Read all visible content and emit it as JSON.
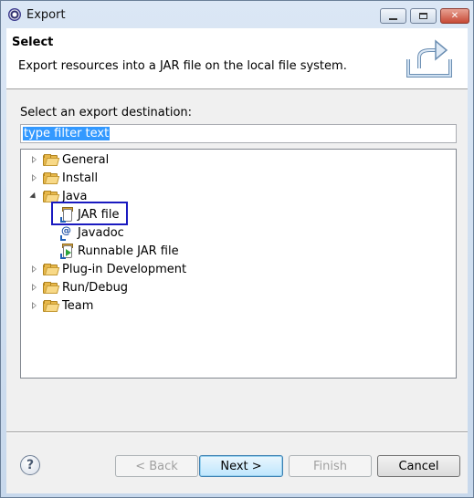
{
  "window": {
    "title": "Export"
  },
  "banner": {
    "title": "Select",
    "description": "Export resources into a JAR file on the local file system.",
    "icon": "export-icon"
  },
  "destination_label": "Select an export destination:",
  "filter": {
    "value": "type filter text"
  },
  "tree": {
    "items": [
      {
        "label": "General",
        "kind": "folder",
        "expanded": false
      },
      {
        "label": "Install",
        "kind": "folder",
        "expanded": false
      },
      {
        "label": "Java",
        "kind": "folder",
        "expanded": true
      },
      {
        "label": "JAR file",
        "kind": "jar",
        "selected": true
      },
      {
        "label": "Javadoc",
        "kind": "javadoc"
      },
      {
        "label": "Runnable JAR file",
        "kind": "runnable-jar"
      },
      {
        "label": "Plug-in Development",
        "kind": "folder",
        "expanded": false
      },
      {
        "label": "Run/Debug",
        "kind": "folder",
        "expanded": false
      },
      {
        "label": "Team",
        "kind": "folder",
        "expanded": false
      }
    ]
  },
  "buttons": {
    "help": "?",
    "back": "< Back",
    "next": "Next >",
    "finish": "Finish",
    "cancel": "Cancel"
  },
  "colors": {
    "selection": "#3399ff",
    "highlight_box": "#1a1ac0"
  }
}
